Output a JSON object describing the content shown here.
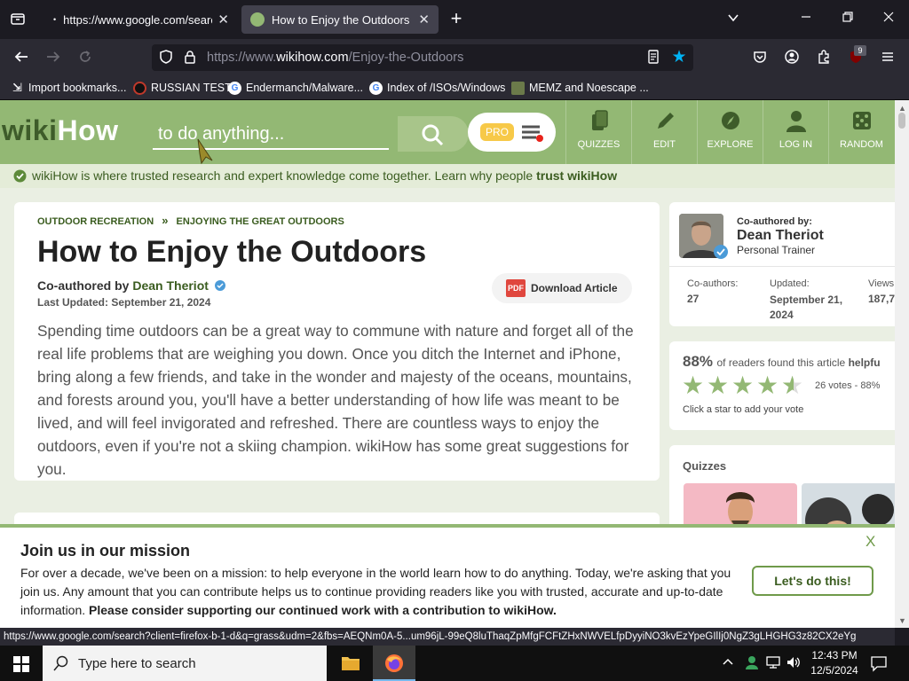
{
  "browser": {
    "tabs": [
      {
        "label": "https://www.google.com/search",
        "active": false
      },
      {
        "label": "How to Enjoy the Outdoors (wit",
        "active": true
      }
    ],
    "url": {
      "prefix": "https://www.",
      "domain": "wikihow.com",
      "path": "/Enjoy-the-Outdoors"
    },
    "extension_badge": "9",
    "bookmarks": [
      "Import bookmarks...",
      "RUSSIAN TEST",
      "Endermanch/Malware...",
      "Index of /ISOs/Windows",
      "MEMZ and Noescape ..."
    ]
  },
  "header": {
    "logo_wiki": "wiki",
    "logo_how": "How",
    "search_placeholder": "to do anything...",
    "pro_label": "PRO",
    "nav": [
      "QUIZZES",
      "EDIT",
      "EXPLORE",
      "LOG IN",
      "RANDOM"
    ]
  },
  "trust": {
    "text": "wikiHow is where trusted research and expert knowledge come together. Learn why people ",
    "bold": "trust wikiHow"
  },
  "article": {
    "breadcrumb": [
      "OUTDOOR RECREATION",
      "ENJOYING THE GREAT OUTDOORS"
    ],
    "breadcrumb_sep": "»",
    "title": "How to Enjoy the Outdoors",
    "coauthored_prefix": "Co-authored by ",
    "author": "Dean Theriot",
    "updated": "Last Updated: September 21, 2024",
    "download_label": "Download Article",
    "pdf_label": "PDF",
    "intro": "Spending time outdoors can be a great way to commune with nature and forget all of the real life problems that are weighing you down. Once you ditch the Internet and iPhone, bring along a few friends, and take in the wonder and majesty of the oceans, mountains, and forests around you, you'll have a better understanding of how life was meant to be lived, and will feel invigorated and refreshed. There are countless ways to enjoy the outdoors, even if you're not a skiing champion. wikiHow has some great suggestions for you."
  },
  "sidebar": {
    "coauthor_label": "Co-authored by:",
    "coauthor_name": "Dean Theriot",
    "coauthor_role": "Personal Trainer",
    "stats": [
      {
        "label": "Co-authors:",
        "value": "27"
      },
      {
        "label": "Updated:",
        "value": "September 21, 2024"
      },
      {
        "label": "Views",
        "value": "187,7"
      }
    ],
    "rating_pct": "88%",
    "rating_text": "of readers found this article ",
    "rating_bold": "helpfu",
    "rating_value": 4.5,
    "votes": "26 votes - 88%",
    "star_hint": "Click a star to add your vote",
    "quizzes_label": "Quizzes"
  },
  "banner": {
    "title": "Join us in our mission",
    "body": "For over a decade, we've been on a mission: to help everyone in the world learn how to do anything. Today, we're asking that you join us. Any amount that you can contribute helps us to continue providing readers like you with trusted, accurate and up-to-date information. ",
    "body_bold": "Please consider supporting our continued work with a contribution to wikiHow.",
    "cta": "Let's do this!",
    "close": "X"
  },
  "status_url": "https://www.google.com/search?client=firefox-b-1-d&q=grass&udm=2&fbs=AEQNm0A-5...um96jL-99eQ8luThaqZpMfgFCFtZHxNWVELfpDyyiNO3kvEzYpeGIlIj0NgZ3gLHGHG3z82CX2eYg",
  "taskbar": {
    "search_placeholder": "Type here to search",
    "time": "12:43 PM",
    "date": "12/5/2024"
  },
  "colors": {
    "wikihow_green": "#93b874",
    "dark_green": "#3a5c1f",
    "star": "#93b874"
  }
}
